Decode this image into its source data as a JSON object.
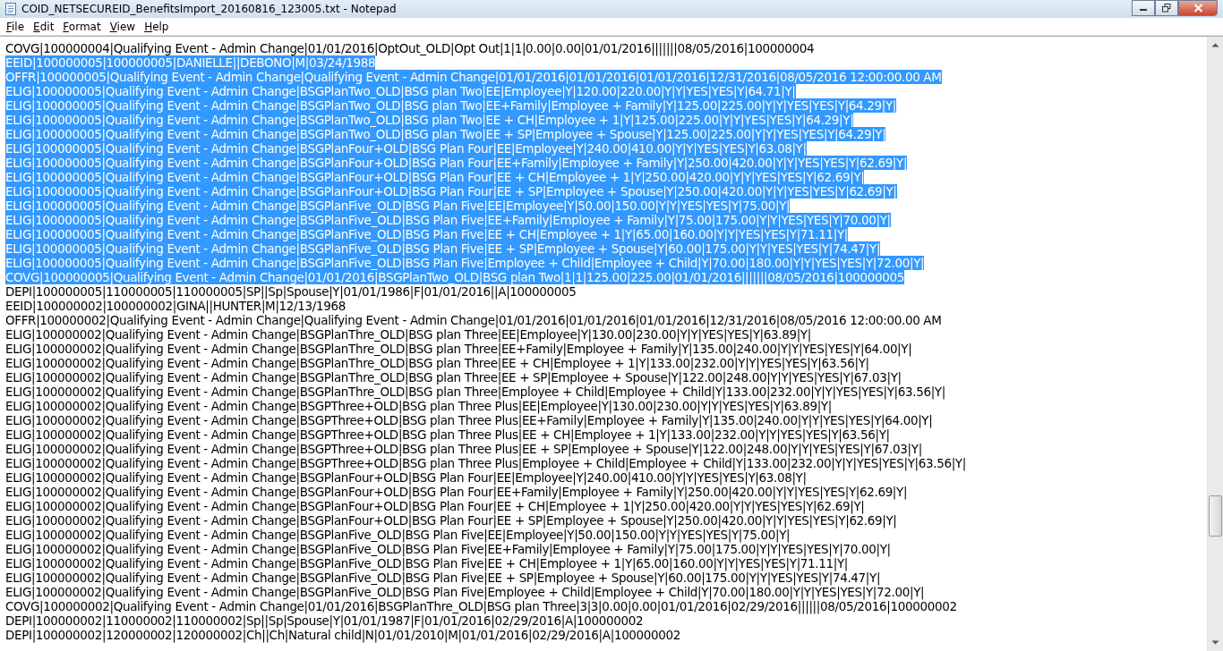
{
  "window": {
    "title": "COID_NETSECUREID_BenefitsImport_20160816_123005.txt - Notepad"
  },
  "menu": [
    "File",
    "Edit",
    "Format",
    "View",
    "Help"
  ],
  "lines": [
    {
      "text": "COVG|100000004|Qualifying Event - Admin Change|01/01/2016|OptOut_OLD|Opt Out|1|1|0.00|0.00|01/01/2016|||||||08/05/2016|100000004",
      "selected": false
    },
    {
      "text": "EEID|100000005|100000005|DANIELLE||DEBONO|M|03/24/1988",
      "selected": true
    },
    {
      "text": "OFFR|100000005|Qualifying Event - Admin Change|Qualifying Event - Admin Change|01/01/2016|01/01/2016|01/01/2016|12/31/2016|08/05/2016 12:00:00.00 AM",
      "selected": true
    },
    {
      "text": "ELIG|100000005|Qualifying Event - Admin Change|BSGPlanTwo_OLD|BSG plan Two|EE|Employee|Y|120.00|220.00|Y|Y|YES|YES|Y|64.71|Y|",
      "selected": true
    },
    {
      "text": "ELIG|100000005|Qualifying Event - Admin Change|BSGPlanTwo_OLD|BSG plan Two|EE+Family|Employee + Family|Y|125.00|225.00|Y|Y|YES|YES|Y|64.29|Y|",
      "selected": true
    },
    {
      "text": "ELIG|100000005|Qualifying Event - Admin Change|BSGPlanTwo_OLD|BSG plan Two|EE + CH|Employee + 1|Y|125.00|225.00|Y|Y|YES|YES|Y|64.29|Y|",
      "selected": true
    },
    {
      "text": "ELIG|100000005|Qualifying Event - Admin Change|BSGPlanTwo_OLD|BSG plan Two|EE + SP|Employee + Spouse|Y|125.00|225.00|Y|Y|YES|YES|Y|64.29|Y|",
      "selected": true
    },
    {
      "text": "ELIG|100000005|Qualifying Event - Admin Change|BSGPlanFour+OLD|BSG Plan Four|EE|Employee|Y|240.00|410.00|Y|Y|YES|YES|Y|63.08|Y|",
      "selected": true
    },
    {
      "text": "ELIG|100000005|Qualifying Event - Admin Change|BSGPlanFour+OLD|BSG Plan Four|EE+Family|Employee + Family|Y|250.00|420.00|Y|Y|YES|YES|Y|62.69|Y|",
      "selected": true
    },
    {
      "text": "ELIG|100000005|Qualifying Event - Admin Change|BSGPlanFour+OLD|BSG Plan Four|EE + CH|Employee + 1|Y|250.00|420.00|Y|Y|YES|YES|Y|62.69|Y|",
      "selected": true
    },
    {
      "text": "ELIG|100000005|Qualifying Event - Admin Change|BSGPlanFour+OLD|BSG Plan Four|EE + SP|Employee + Spouse|Y|250.00|420.00|Y|Y|YES|YES|Y|62.69|Y|",
      "selected": true
    },
    {
      "text": "ELIG|100000005|Qualifying Event - Admin Change|BSGPlanFive_OLD|BSG Plan Five|EE|Employee|Y|50.00|150.00|Y|Y|YES|YES|Y|75.00|Y|",
      "selected": true
    },
    {
      "text": "ELIG|100000005|Qualifying Event - Admin Change|BSGPlanFive_OLD|BSG Plan Five|EE+Family|Employee + Family|Y|75.00|175.00|Y|Y|YES|YES|Y|70.00|Y|",
      "selected": true
    },
    {
      "text": "ELIG|100000005|Qualifying Event - Admin Change|BSGPlanFive_OLD|BSG Plan Five|EE + CH|Employee + 1|Y|65.00|160.00|Y|Y|YES|YES|Y|71.11|Y|",
      "selected": true
    },
    {
      "text": "ELIG|100000005|Qualifying Event - Admin Change|BSGPlanFive_OLD|BSG Plan Five|EE + SP|Employee + Spouse|Y|60.00|175.00|Y|Y|YES|YES|Y|74.47|Y|",
      "selected": true
    },
    {
      "text": "ELIG|100000005|Qualifying Event - Admin Change|BSGPlanFive_OLD|BSG Plan Five|Employee + Child|Employee + Child|Y|70.00|180.00|Y|Y|YES|YES|Y|72.00|Y|",
      "selected": true
    },
    {
      "text": "COVG|100000005|Qualifying Event - Admin Change|01/01/2016|BSGPlanTwo_OLD|BSG plan Two|1|1|125.00|225.00|01/01/2016|||||||08/05/2016|100000005",
      "selected": true
    },
    {
      "text": "DEPI|100000005|110000005|110000005|SP||Sp|Spouse|Y|01/01/1986|F|01/01/2016||A|100000005",
      "selected": false
    },
    {
      "text": "EEID|100000002|100000002|GINA||HUNTER|M|12/13/1968",
      "selected": false
    },
    {
      "text": "OFFR|100000002|Qualifying Event - Admin Change|Qualifying Event - Admin Change|01/01/2016|01/01/2016|01/01/2016|12/31/2016|08/05/2016 12:00:00.00 AM",
      "selected": false
    },
    {
      "text": "ELIG|100000002|Qualifying Event - Admin Change|BSGPlanThre_OLD|BSG plan Three|EE|Employee|Y|130.00|230.00|Y|Y|YES|YES|Y|63.89|Y|",
      "selected": false
    },
    {
      "text": "ELIG|100000002|Qualifying Event - Admin Change|BSGPlanThre_OLD|BSG plan Three|EE+Family|Employee + Family|Y|135.00|240.00|Y|Y|YES|YES|Y|64.00|Y|",
      "selected": false
    },
    {
      "text": "ELIG|100000002|Qualifying Event - Admin Change|BSGPlanThre_OLD|BSG plan Three|EE + CH|Employee + 1|Y|133.00|232.00|Y|Y|YES|YES|Y|63.56|Y|",
      "selected": false
    },
    {
      "text": "ELIG|100000002|Qualifying Event - Admin Change|BSGPlanThre_OLD|BSG plan Three|EE + SP|Employee + Spouse|Y|122.00|248.00|Y|Y|YES|YES|Y|67.03|Y|",
      "selected": false
    },
    {
      "text": "ELIG|100000002|Qualifying Event - Admin Change|BSGPlanThre_OLD|BSG plan Three|Employee + Child|Employee + Child|Y|133.00|232.00|Y|Y|YES|YES|Y|63.56|Y|",
      "selected": false
    },
    {
      "text": "ELIG|100000002|Qualifying Event - Admin Change|BSGPThree+OLD|BSG plan Three Plus|EE|Employee|Y|130.00|230.00|Y|Y|YES|YES|Y|63.89|Y|",
      "selected": false
    },
    {
      "text": "ELIG|100000002|Qualifying Event - Admin Change|BSGPThree+OLD|BSG plan Three Plus|EE+Family|Employee + Family|Y|135.00|240.00|Y|Y|YES|YES|Y|64.00|Y|",
      "selected": false
    },
    {
      "text": "ELIG|100000002|Qualifying Event - Admin Change|BSGPThree+OLD|BSG plan Three Plus|EE + CH|Employee + 1|Y|133.00|232.00|Y|Y|YES|YES|Y|63.56|Y|",
      "selected": false
    },
    {
      "text": "ELIG|100000002|Qualifying Event - Admin Change|BSGPThree+OLD|BSG plan Three Plus|EE + SP|Employee + Spouse|Y|122.00|248.00|Y|Y|YES|YES|Y|67.03|Y|",
      "selected": false
    },
    {
      "text": "ELIG|100000002|Qualifying Event - Admin Change|BSGPThree+OLD|BSG plan Three Plus|Employee + Child|Employee + Child|Y|133.00|232.00|Y|Y|YES|YES|Y|63.56|Y|",
      "selected": false
    },
    {
      "text": "ELIG|100000002|Qualifying Event - Admin Change|BSGPlanFour+OLD|BSG Plan Four|EE|Employee|Y|240.00|410.00|Y|Y|YES|YES|Y|63.08|Y|",
      "selected": false
    },
    {
      "text": "ELIG|100000002|Qualifying Event - Admin Change|BSGPlanFour+OLD|BSG Plan Four|EE+Family|Employee + Family|Y|250.00|420.00|Y|Y|YES|YES|Y|62.69|Y|",
      "selected": false
    },
    {
      "text": "ELIG|100000002|Qualifying Event - Admin Change|BSGPlanFour+OLD|BSG Plan Four|EE + CH|Employee + 1|Y|250.00|420.00|Y|Y|YES|YES|Y|62.69|Y|",
      "selected": false
    },
    {
      "text": "ELIG|100000002|Qualifying Event - Admin Change|BSGPlanFour+OLD|BSG Plan Four|EE + SP|Employee + Spouse|Y|250.00|420.00|Y|Y|YES|YES|Y|62.69|Y|",
      "selected": false
    },
    {
      "text": "ELIG|100000002|Qualifying Event - Admin Change|BSGPlanFive_OLD|BSG Plan Five|EE|Employee|Y|50.00|150.00|Y|Y|YES|YES|Y|75.00|Y|",
      "selected": false
    },
    {
      "text": "ELIG|100000002|Qualifying Event - Admin Change|BSGPlanFive_OLD|BSG Plan Five|EE+Family|Employee + Family|Y|75.00|175.00|Y|Y|YES|YES|Y|70.00|Y|",
      "selected": false
    },
    {
      "text": "ELIG|100000002|Qualifying Event - Admin Change|BSGPlanFive_OLD|BSG Plan Five|EE + CH|Employee + 1|Y|65.00|160.00|Y|Y|YES|YES|Y|71.11|Y|",
      "selected": false
    },
    {
      "text": "ELIG|100000002|Qualifying Event - Admin Change|BSGPlanFive_OLD|BSG Plan Five|EE + SP|Employee + Spouse|Y|60.00|175.00|Y|Y|YES|YES|Y|74.47|Y|",
      "selected": false
    },
    {
      "text": "ELIG|100000002|Qualifying Event - Admin Change|BSGPlanFive_OLD|BSG Plan Five|Employee + Child|Employee + Child|Y|70.00|180.00|Y|Y|YES|YES|Y|72.00|Y|",
      "selected": false
    },
    {
      "text": "COVG|100000002|Qualifying Event - Admin Change|01/01/2016|BSGPlanThre_OLD|BSG plan Three|3|3|0.00|0.00|01/01/2016|02/29/2016||||||08/05/2016|100000002",
      "selected": false
    },
    {
      "text": "DEPI|100000002|110000002|110000002|Sp||Sp|Spouse|Y|01/01/1987|F|01/01/2016|02/29/2016|A|100000002",
      "selected": false
    },
    {
      "text": "DEPI|100000002|120000002|120000002|Ch||Ch|Natural child|N|01/01/2010|M|01/01/2016|02/29/2016|A|100000002",
      "selected": false
    }
  ]
}
